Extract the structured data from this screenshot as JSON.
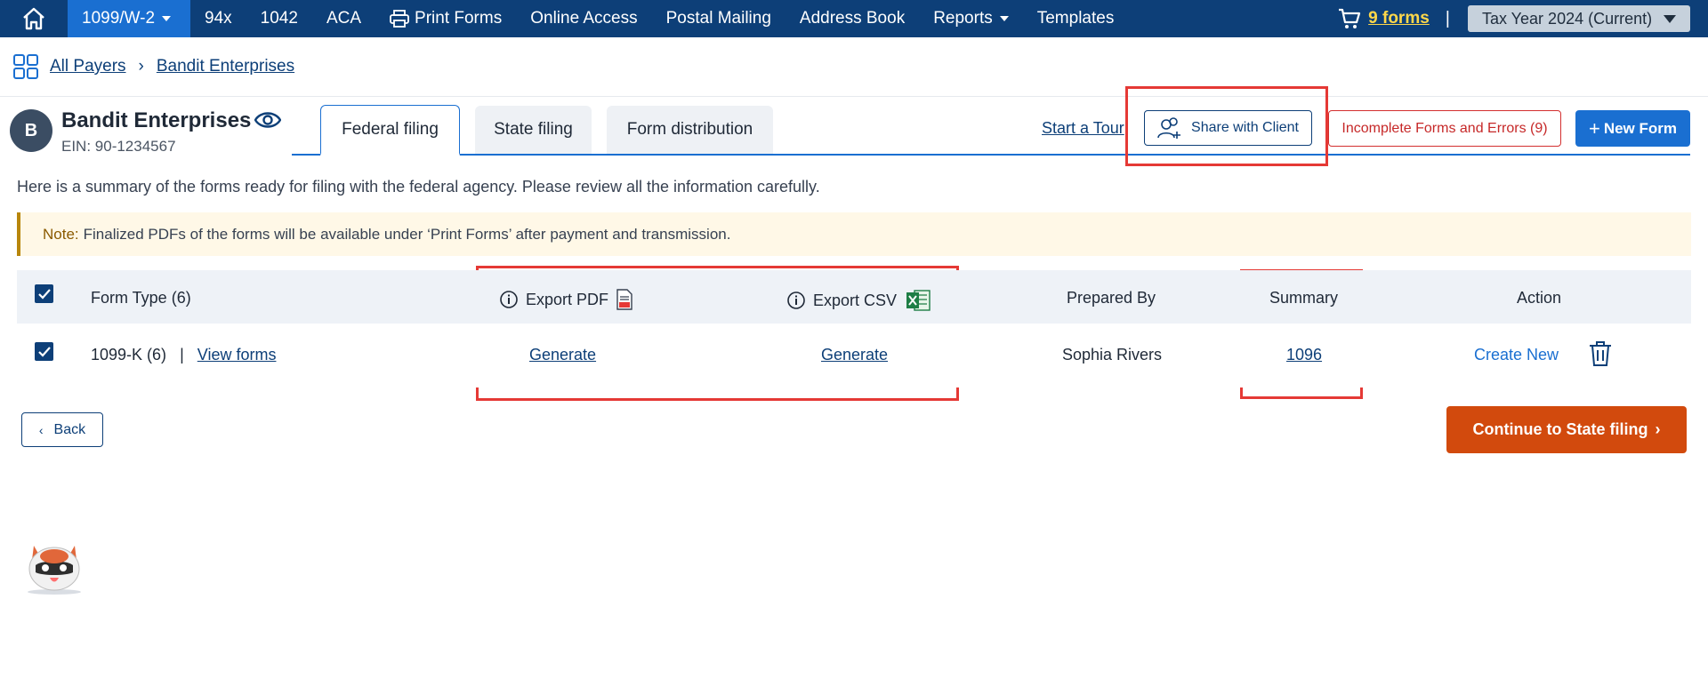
{
  "nav": {
    "items": [
      "1099/W-2",
      "94x",
      "1042",
      "ACA",
      "Print Forms",
      "Online Access",
      "Postal Mailing",
      "Address Book",
      "Reports",
      "Templates"
    ],
    "cart_label": "9 forms",
    "separator": "|",
    "tax_year": "Tax Year 2024 (Current)"
  },
  "breadcrumb": {
    "root": "All Payers",
    "current": "Bandit Enterprises"
  },
  "payer": {
    "initial": "B",
    "name": "Bandit Enterprises",
    "ein": "EIN: 90-1234567"
  },
  "tabs": [
    "Federal filing",
    "State filing",
    "Form distribution"
  ],
  "actions": {
    "tour": "Start a Tour",
    "share": "Share with Client",
    "errors": "Incomplete Forms and Errors (9)",
    "new_form": "New Form",
    "plus": "+"
  },
  "summary_text": "Here is a summary of the forms ready for filing with the federal agency. Please review all the information carefully.",
  "note": {
    "label": "Note:",
    "text": "Finalized PDFs of the forms will be available under ‘Print Forms’ after payment and transmission."
  },
  "table": {
    "headers": {
      "form_type": "Form Type  (6)",
      "export_pdf": "Export PDF",
      "export_csv": "Export CSV",
      "prepared_by": "Prepared By",
      "summary": "Summary",
      "action": "Action"
    },
    "row": {
      "form": "1099-K (6)",
      "sep": "|",
      "view": "View forms",
      "pdf": "Generate",
      "csv": "Generate",
      "prepared_by": "Sophia Rivers",
      "summary": "1096",
      "create": "Create New"
    }
  },
  "footer": {
    "back": "Back",
    "continue": "Continue to State filing"
  },
  "colors": {
    "nav_bg": "#0d3f78",
    "accent": "#1a6fd1",
    "continue": "#d24a0d",
    "highlight": "#e53935"
  }
}
